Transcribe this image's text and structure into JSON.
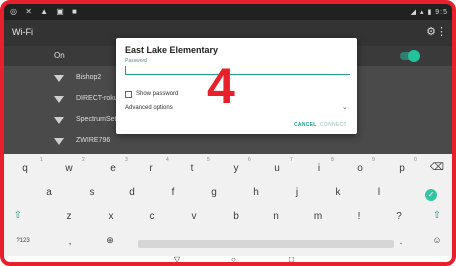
{
  "status_bar": {
    "left_icons": "◎ ✕ ▲ ▣ ■",
    "right_text": "◢ ▴ ▮ 9:5"
  },
  "app_bar": {
    "title": "Wi-Fi",
    "settings_icon": "gear-icon",
    "more_icon": "more-vert-icon"
  },
  "wifi_toggle": {
    "label": "On",
    "on": true
  },
  "networks": [
    {
      "name": "Bishop2"
    },
    {
      "name": "DIRECT-roku-57"
    },
    {
      "name": "SpectrumSetup"
    },
    {
      "name": "ZWIRE796"
    }
  ],
  "dialog": {
    "title": "East Lake Elementary",
    "password_label": "Password",
    "password_value": "",
    "show_password_label": "Show password",
    "advanced_options_label": "Advanced options",
    "cancel_label": "CANCEL",
    "connect_label": "CONNECT"
  },
  "annotation": "4",
  "keyboard": {
    "row1": [
      "q",
      "w",
      "e",
      "r",
      "t",
      "y",
      "u",
      "i",
      "o",
      "p"
    ],
    "row1_hints": [
      "1",
      "2",
      "3",
      "4",
      "5",
      "6",
      "7",
      "8",
      "9",
      "0"
    ],
    "row2": [
      "a",
      "s",
      "d",
      "f",
      "g",
      "h",
      "j",
      "k",
      "l"
    ],
    "row3": [
      "z",
      "x",
      "c",
      "v",
      "b",
      "n",
      "m",
      "!",
      "?"
    ],
    "symbols_label": "?123",
    "comma": ",",
    "period": ".",
    "backspace_icon": "⌫",
    "shift_icon": "⇧",
    "go_icon": "✓",
    "globe_icon": "⊕",
    "emoji_icon": "☺"
  },
  "nav": {
    "back": "▽",
    "home": "○",
    "recents": "□"
  },
  "colors": {
    "frame": "#e8202c",
    "accent": "#1f9a88",
    "toggle": "#22c39a"
  }
}
